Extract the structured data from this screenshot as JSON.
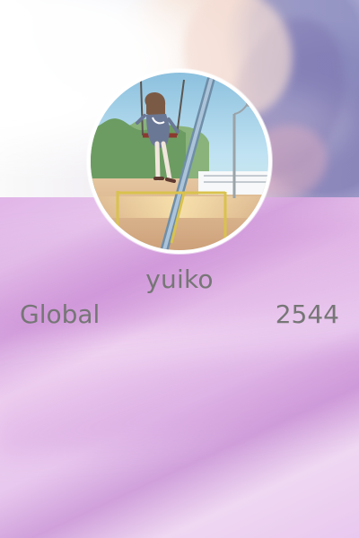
{
  "profile": {
    "username": "yuiko",
    "stats": {
      "label": "Global",
      "value": "2544"
    }
  },
  "avatar": {
    "icon": "avatar-illustration"
  },
  "colors": {
    "text": "#767676",
    "panel_purple": "#e1b5e8",
    "avatar_border": "#ffffff"
  }
}
